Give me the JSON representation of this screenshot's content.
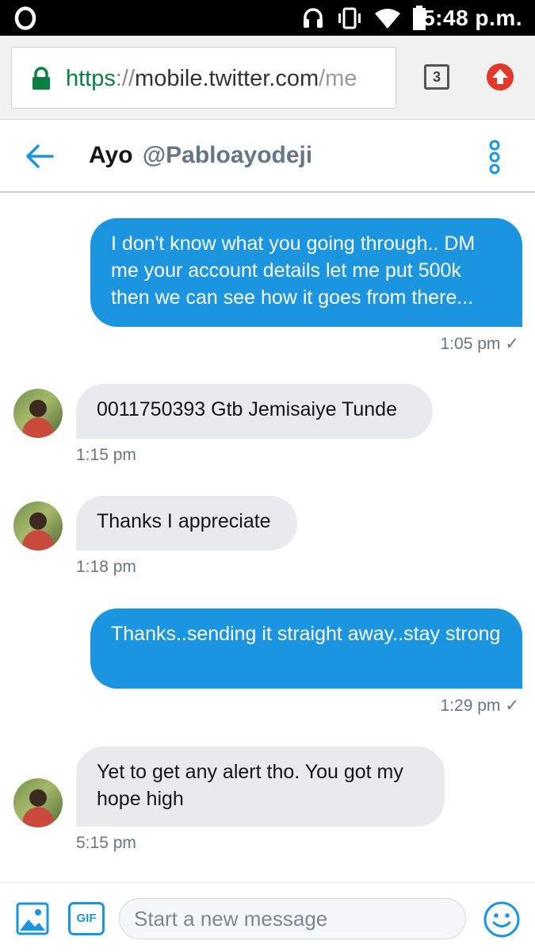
{
  "status_bar": {
    "time": "5:48 p.m.",
    "icons": [
      "opera-icon",
      "headset-icon",
      "vibrate-icon",
      "wifi-icon",
      "battery-icon"
    ]
  },
  "browser": {
    "url_scheme": "https",
    "url_separator": "://",
    "url_host": "mobile.twitter.com",
    "url_path": "/me",
    "tab_count": "3",
    "secure_color": "#0b8043",
    "update_color": "#e0392b"
  },
  "conversation": {
    "name": "Ayo",
    "handle": "@Pabloayodeji"
  },
  "messages": [
    {
      "direction": "sent",
      "text": "I don't know what you going through.. DM me your account details let me put 500k then we can see how it goes from there...",
      "time": "1:05 pm",
      "status": "✓"
    },
    {
      "direction": "received",
      "text": "0011750393 Gtb Jemisaiye Tunde",
      "time": "1:15 pm"
    },
    {
      "direction": "received",
      "text": "Thanks I appreciate",
      "time": "1:18 pm"
    },
    {
      "direction": "sent",
      "text": "Thanks..sending  it straight away..stay strong",
      "time": "1:29 pm",
      "status": "✓"
    },
    {
      "direction": "received",
      "text": "Yet to get any alert tho. You got my hope high",
      "time": "5:15 pm"
    }
  ],
  "composer": {
    "gif_label": "GIF",
    "placeholder": "Start a new message"
  },
  "colors": {
    "accent": "#1b95e0",
    "sent_bubble": "#1b95e0",
    "received_bubble": "#e8ebee",
    "meta_text": "#657786"
  }
}
